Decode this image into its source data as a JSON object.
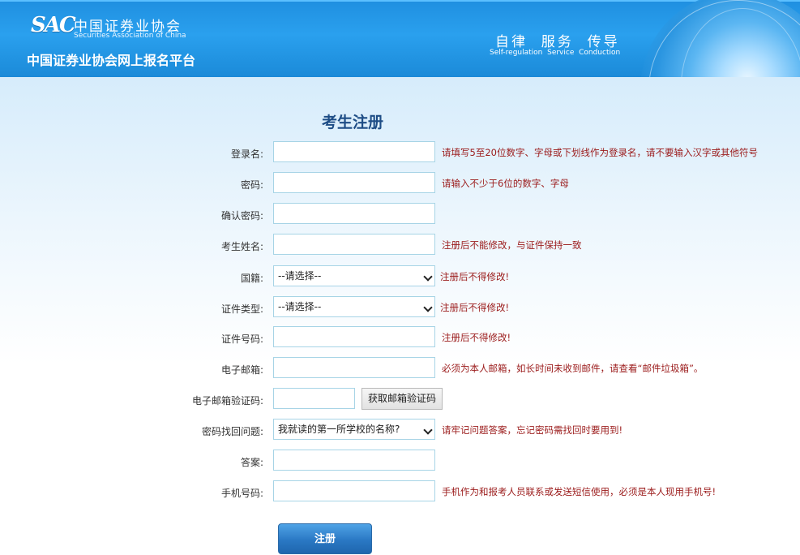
{
  "header": {
    "logo_mark": "SAC",
    "logo_cn": "中国证券业协会",
    "logo_en": "Securities Association of China",
    "platform_title": "中国证券业协会网上报名平台",
    "motto_cn": "自律  服务  传导",
    "motto_en": "Self-regulation  Service  Conduction"
  },
  "form": {
    "title": "考生注册",
    "fields": {
      "login": {
        "label": "登录名:",
        "value": "",
        "hint": "请填写5至20位数字、字母或下划线作为登录名，请不要输入汉字或其他符号"
      },
      "password": {
        "label": "密码:",
        "value": "",
        "hint": "请输入不少于6位的数字、字母"
      },
      "confirm": {
        "label": "确认密码:",
        "value": ""
      },
      "name": {
        "label": "考生姓名:",
        "value": "",
        "hint": "注册后不能修改，与证件保持一致"
      },
      "nationality": {
        "label": "国籍:",
        "selected": "--请选择--",
        "hint": "注册后不得修改!"
      },
      "id_type": {
        "label": "证件类型:",
        "selected": "--请选择--",
        "hint": "注册后不得修改!"
      },
      "id_number": {
        "label": "证件号码:",
        "value": "",
        "hint": "注册后不得修改!"
      },
      "email": {
        "label": "电子邮箱:",
        "value": "",
        "hint": "必须为本人邮箱，如长时间未收到邮件，请查看“邮件垃圾箱”。"
      },
      "email_code": {
        "label": "电子邮箱验证码:",
        "value": "",
        "button": "获取邮箱验证码"
      },
      "question": {
        "label": "密码找回问题:",
        "selected": "我就读的第一所学校的名称?",
        "hint": "请牢记问题答案，忘记密码需找回时要用到!"
      },
      "answer": {
        "label": "答案:",
        "value": ""
      },
      "mobile": {
        "label": "手机号码:",
        "value": "",
        "hint": "手机作为和报考人员联系或发送短信使用，必须是本人现用手机号!"
      }
    },
    "submit_label": "注册"
  }
}
